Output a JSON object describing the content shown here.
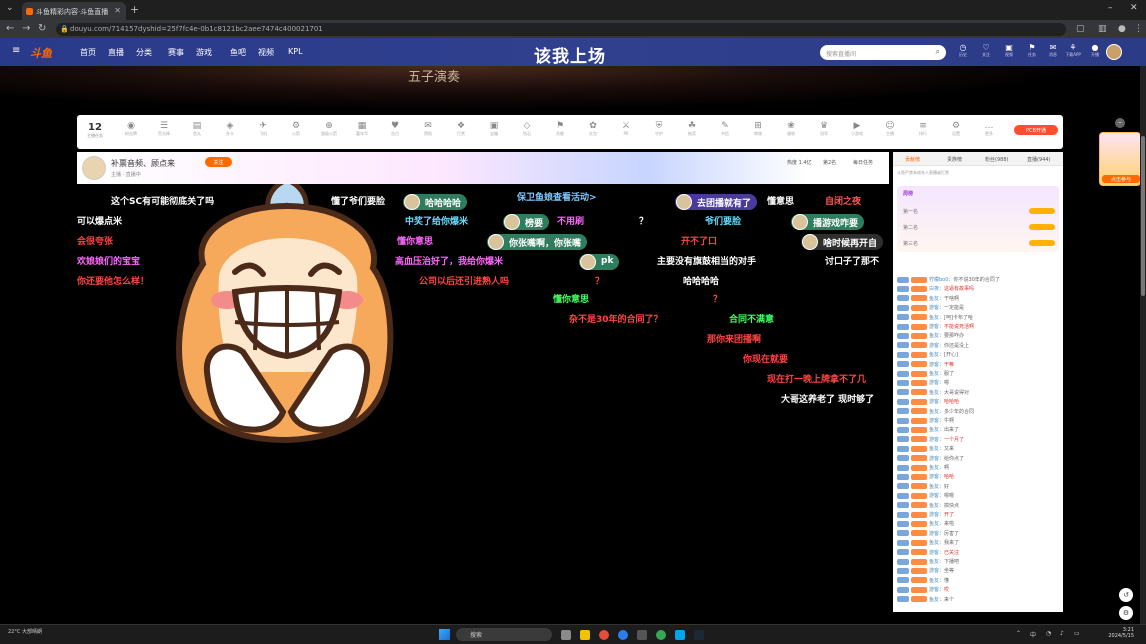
{
  "browser": {
    "tab_title": "斗鱼精彩内容·斗鱼直播",
    "url": "douyu.com/714157dyshid=25f7fc4e-0b1c8121bc2aee7474c400021701",
    "new_tab": "+",
    "minimize": "–",
    "close": "✕"
  },
  "site": {
    "logo": "斗鱼",
    "nav": [
      "首页",
      "直播",
      "分类",
      "赛事",
      "游戏",
      "鱼吧",
      "视频",
      "KPL"
    ],
    "promo": "该我上场",
    "search_placeholder": "搜索直播间",
    "header_icons": [
      {
        "name": "history-icon",
        "glyph": "◷",
        "label": "历史"
      },
      {
        "name": "follow-icon",
        "glyph": "♡",
        "label": "关注"
      },
      {
        "name": "video-icon",
        "glyph": "▣",
        "label": "视频"
      },
      {
        "name": "gift-icon",
        "glyph": "⚑",
        "label": "任务"
      },
      {
        "name": "message-icon",
        "glyph": "✉",
        "label": "消息"
      },
      {
        "name": "app-icon",
        "glyph": "⚘",
        "label": "下载APP"
      },
      {
        "name": "live-icon",
        "glyph": "●",
        "label": "开播"
      }
    ]
  },
  "banner_text": "五子演奏",
  "giftbar": {
    "count": "12",
    "count_label": "主播任务",
    "items": [
      "粉丝牌",
      "荧光棒",
      "鱼丸",
      "办卡",
      "飞机",
      "火箭",
      "超级火箭",
      "嘉年华",
      "告白",
      "赞助",
      "打赏",
      "宝箱",
      "钻石",
      "贡献",
      "礼包",
      "PK",
      "守护",
      "抽奖",
      "书信",
      "商城",
      "福袋",
      "冠军",
      "小游戏",
      "主播",
      "排行",
      "设置",
      "更多"
    ],
    "buy": "PCB开通"
  },
  "infobar": {
    "title": "补票音频、顾点来",
    "follow": "关注",
    "sub": "主播 · 直播中",
    "right": [
      "热度 1.4亿",
      "第2名",
      "每日任务"
    ]
  },
  "danmaku": [
    {
      "text": "这个SC有可能彻底关了吗",
      "color": "#ffffff"
    },
    {
      "text": "懂了爷们要脸",
      "color": "#ffffff"
    },
    {
      "text": "保卫鱼娘查看活动>",
      "color": "#7fc8ff"
    },
    {
      "text": "懂意思",
      "color": "#ffffff"
    },
    {
      "text": "自闭之夜",
      "color": "#ff5555"
    },
    {
      "text": "可以爆点米",
      "color": "#ffffff"
    },
    {
      "text": "中奖了给你爆米",
      "color": "#66ddff"
    },
    {
      "text": "不用刷",
      "color": "#ff66ff"
    },
    {
      "text": "？",
      "color": "#ffffff"
    },
    {
      "text": "爷们要脸",
      "color": "#66ddff"
    },
    {
      "text": "会很夸张",
      "color": "#ff4444"
    },
    {
      "text": "懂你意思",
      "color": "#ff66ff"
    },
    {
      "text": "开不了口",
      "color": "#ff4444"
    },
    {
      "text": "欢娘娘们的宝宝",
      "color": "#ff66ff"
    },
    {
      "text": "高血压治好了，我给你爆米",
      "color": "#ff66ff"
    },
    {
      "text": "主要没有旗鼓相当的对手",
      "color": "#ffffff"
    },
    {
      "text": "讨口子了那不",
      "color": "#ffffff"
    },
    {
      "text": "你还要他怎么样！",
      "color": "#ff4444"
    },
    {
      "text": "公司以后还引进熟人吗",
      "color": "#ff4444"
    },
    {
      "text": "？",
      "color": "#ff4444"
    },
    {
      "text": "哈哈哈哈",
      "color": "#ffffff"
    },
    {
      "text": "懂你意思",
      "color": "#44ff66"
    },
    {
      "text": "？",
      "color": "#ff4444"
    },
    {
      "text": "杂不是30年的合同了？",
      "color": "#ff4444"
    },
    {
      "text": "合同不满意",
      "color": "#44ff66"
    },
    {
      "text": "那你来团播啊",
      "color": "#ff4444"
    },
    {
      "text": "你现在就要",
      "color": "#ff4444"
    },
    {
      "text": "现在打一晚上牌拿不了几",
      "color": "#ff4444"
    },
    {
      "text": "大哥这养老了 现时够了",
      "color": "#ffffff"
    }
  ],
  "pills": [
    {
      "text": "哈哈哈哈",
      "color": "#2e7d5e"
    },
    {
      "text": "榜要",
      "color": "#2e7d5e"
    },
    {
      "text": "你张嘴啊，你张嘴",
      "color": "#2e7d5e"
    },
    {
      "text": "pk",
      "color": "#2e7d5e"
    },
    {
      "text": "去团播就有了",
      "color": "#4a3aa0"
    },
    {
      "text": "播游戏咋要",
      "color": "#2e7d5e"
    },
    {
      "text": "啥时候再开自",
      "color": "#2e2e2e"
    }
  ],
  "chat": {
    "tabs": [
      "贡献榜",
      "贵族榜",
      "粉丝(988)",
      "直播(944)"
    ],
    "notice": "斗鱼严禁未成年人直播或打赏",
    "box_rows": [
      "周榜",
      "第一名",
      "第二名",
      "第三名"
    ],
    "messages": [
      {
        "name": "柠檬bo0",
        "text": "你不说30年的合同了"
      },
      {
        "name": "白夜",
        "text": "这逼有故事吗"
      },
      {
        "name": "鱼友",
        "text": "干啥啊"
      },
      {
        "name": "游客",
        "text": "一定能是"
      },
      {
        "name": "鱼友",
        "text": "[呵]卡布了哈"
      },
      {
        "name": "游客",
        "text": "不能说死活啊"
      },
      {
        "name": "鱼友",
        "text": "要那咋办"
      },
      {
        "name": "游客",
        "text": "你还是没上"
      },
      {
        "name": "鱼友",
        "text": "[开心]"
      },
      {
        "name": "游客",
        "text": "干嘛"
      },
      {
        "name": "鱼友",
        "text": "服了"
      },
      {
        "name": "游客",
        "text": "嗯"
      },
      {
        "name": "鱼友",
        "text": "大哥说得对"
      },
      {
        "name": "游客",
        "text": "哈哈哈"
      },
      {
        "name": "鱼友",
        "text": "多少年的合同"
      },
      {
        "name": "游客",
        "text": "牛啊"
      },
      {
        "name": "鱼友",
        "text": "出来了"
      },
      {
        "name": "游客",
        "text": "一个月了"
      },
      {
        "name": "鱼友",
        "text": "又来"
      },
      {
        "name": "游客",
        "text": "给你点了"
      },
      {
        "name": "鱼友",
        "text": "啊"
      },
      {
        "name": "游客",
        "text": "哈哈"
      },
      {
        "name": "鱼友",
        "text": "好"
      },
      {
        "name": "游客",
        "text": "嗯嗯"
      },
      {
        "name": "鱼友",
        "text": "搞快点"
      },
      {
        "name": "游客",
        "text": "开了"
      },
      {
        "name": "鱼友",
        "text": "来啦"
      },
      {
        "name": "游客",
        "text": "厉害了"
      },
      {
        "name": "鱼友",
        "text": "我来了"
      },
      {
        "name": "游客",
        "text": "已关注"
      },
      {
        "name": "鱼友",
        "text": "下播吧"
      },
      {
        "name": "游客",
        "text": "坐等"
      },
      {
        "name": "鱼友",
        "text": "懂"
      },
      {
        "name": "游客",
        "text": "哎"
      },
      {
        "name": "鱼友",
        "text": "来个"
      }
    ]
  },
  "side_activity": "点击参与",
  "taskbar": {
    "weather": "22°C 大部晴朗",
    "search": "搜索",
    "time": "3:21",
    "date": "2024/5/15",
    "lang": "中"
  }
}
